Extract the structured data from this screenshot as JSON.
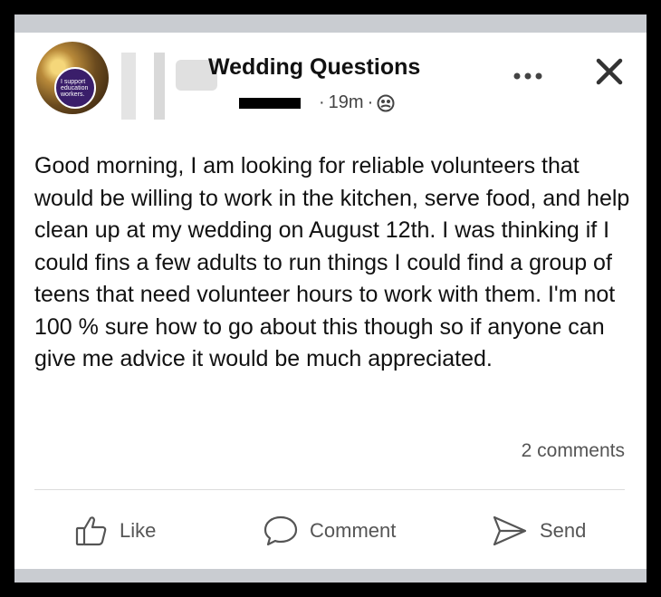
{
  "post": {
    "group_name": "Wedding Questions",
    "time": "19m",
    "separator": "·",
    "avatar_badge_text": "I support education workers.",
    "body": "Good morning, I am looking for reliable volunteers that would be willing to work in the kitchen, serve food, and help clean up at my wedding on August 12th. I was thinking if I could fins a few adults to run things I could find a group of teens that need volunteer hours to work with them. I'm not 100 % sure how to go about this though so if anyone can give me advice it would be much appreciated.",
    "comments_count": "2 comments"
  },
  "actions": {
    "like_label": "Like",
    "comment_label": "Comment",
    "send_label": "Send"
  },
  "icons": {
    "more": "more-horizontal-icon",
    "close": "close-icon",
    "audience": "globe-icon",
    "like": "thumbs-up-icon",
    "comment": "comment-bubble-icon",
    "send": "send-arrow-icon"
  },
  "colors": {
    "background_frame": "#000000",
    "gray_band": "#c9ccd1",
    "text_primary": "#111111",
    "text_secondary": "#555555"
  }
}
